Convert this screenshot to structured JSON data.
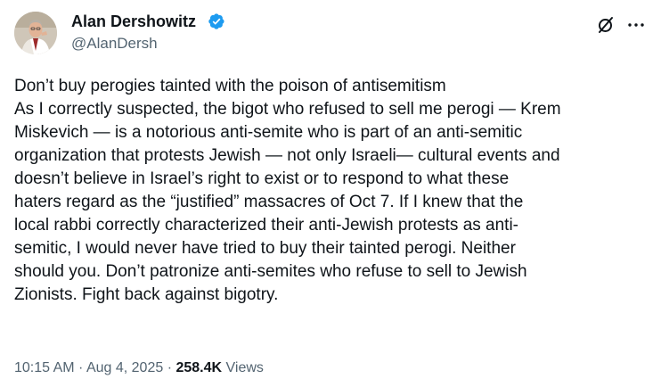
{
  "author": {
    "display_name": "Alan Dershowitz",
    "handle": "@AlanDersh",
    "verified": true,
    "verified_color": "#1d9bf0"
  },
  "icons": {
    "verified": "verified-badge-icon",
    "grok": "grok-icon",
    "more": "more-options-icon"
  },
  "tweet": {
    "lines": [
      "Don’t buy perogies tainted with the poison of antisemitism",
      "As I correctly suspected, the bigot who refused to sell me perogi — Krem",
      "Miskevich —  is a notorious anti-semite who is part of an anti-semitic",
      "organization that protests Jewish — not only Israeli— cultural events and",
      "doesn’t believe in Israel’s right to exist or to respond to what these",
      "haters regard as the “justified” massacres of Oct 7. If I knew that the",
      "local rabbi correctly characterized their anti-Jewish protests as anti-",
      "semitic, I would never have tried to buy their tainted perogi. Neither",
      "should you. Don’t patronize anti-semites who refuse to sell to Jewish",
      "Zionists. Fight back against bigotry."
    ]
  },
  "meta": {
    "time": "10:15 AM",
    "separator": " · ",
    "date": "Aug 4, 2025",
    "separator2": " · ",
    "views_count": "258.4K",
    "views_label": " Views"
  },
  "colors": {
    "text_primary": "#0f1419",
    "text_secondary": "#536471",
    "accent": "#1d9bf0"
  }
}
